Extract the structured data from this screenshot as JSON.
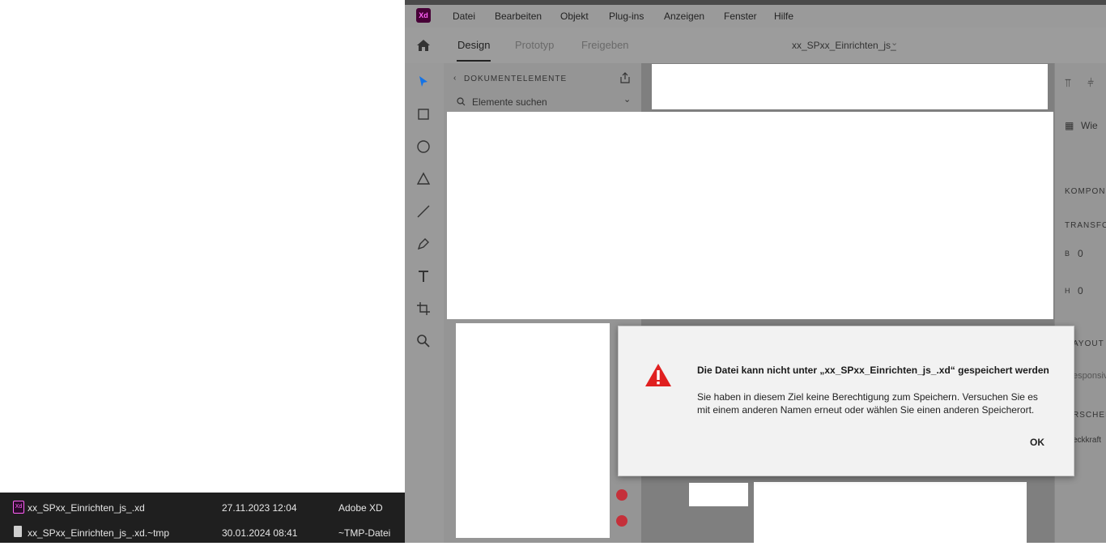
{
  "xd": {
    "logo": "Xd",
    "menu": [
      "Datei",
      "Bearbeiten",
      "Objekt",
      "Plug-ins",
      "Anzeigen",
      "Fenster",
      "Hilfe"
    ],
    "tabs": [
      "Design",
      "Prototyp",
      "Freigeben"
    ],
    "document_title": "xx_SPxx_Einrichten_js_",
    "layers_header": "DOKUMENTELEMENTE",
    "search_placeholder": "Elemente suchen",
    "props": {
      "view_label": "Wie",
      "components": "KOMPONE",
      "transform": "TRANSFOR",
      "b_label": "B",
      "b_value": "0",
      "h_label": "H",
      "h_value": "0",
      "layout": "AYOUT",
      "responsive": "esponsiv",
      "appearance": "RSCHEIN",
      "opacity": "eckkraft"
    }
  },
  "dialog": {
    "title": "Die Datei kann nicht unter „xx_SPxx_Einrichten_js_.xd“ gespeichert werden",
    "body": "Sie haben in diesem Ziel keine Berechtigung zum Speichern. Versuchen Sie es mit einem anderen Namen erneut oder wählen Sie einen anderen Speicherort.",
    "ok": "OK"
  },
  "files": [
    {
      "icon": "xd-file-icon",
      "badge": "Xd",
      "name": "xx_SPxx_Einrichten_js_.xd",
      "date": "27.11.2023 12:04",
      "type": "Adobe XD"
    },
    {
      "icon": "tmp-file-icon",
      "name": "xx_SPxx_Einrichten_js_.xd.~tmp",
      "date": "30.01.2024 08:41",
      "type": "~TMP-Datei"
    }
  ],
  "colors": {
    "accent": "#1473e6",
    "warning": "#e02020",
    "xd_brand": "#470137"
  }
}
